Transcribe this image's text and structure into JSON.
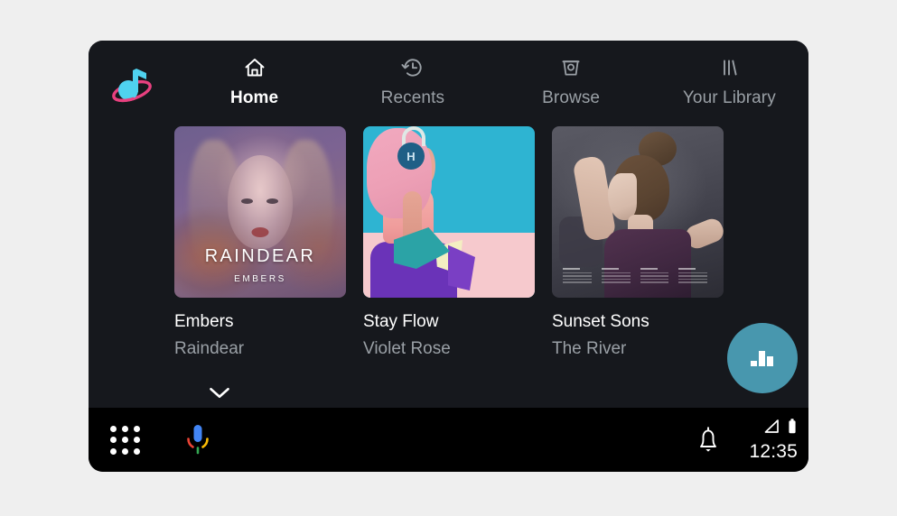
{
  "app": {
    "logo_icon": "music-note-orbit-logo",
    "background_color": "#16181d",
    "page_background": "#efefef",
    "accent_color": "#4897ae",
    "muted_text_color": "#9aa0a6"
  },
  "nav": {
    "tabs": [
      {
        "label": "Home",
        "icon": "home-icon",
        "active": true
      },
      {
        "label": "Recents",
        "icon": "history-icon",
        "active": false
      },
      {
        "label": "Browse",
        "icon": "browse-icon",
        "active": false
      },
      {
        "label": "Your Library",
        "icon": "library-icon",
        "active": false
      }
    ]
  },
  "scrollbar": {
    "up_icon": "chevron-up-icon",
    "down_icon": "chevron-down-icon"
  },
  "content": {
    "cards": [
      {
        "title": "Embers",
        "subtitle": "Raindear",
        "art_name": "album-art-embers",
        "art_wordmark": "RAINDEAR",
        "art_sub": "EMBERS"
      },
      {
        "title": "Stay Flow",
        "subtitle": "Violet Rose",
        "art_name": "album-art-stay-flow",
        "art_badge": "H"
      },
      {
        "title": "Sunset Sons",
        "subtitle": "The River",
        "art_name": "album-art-sunset-sons"
      }
    ],
    "peek_row": [
      {
        "art_name": "album-art-peek-pink"
      },
      {
        "art_name": "album-art-peek-navy"
      },
      {
        "art_name": "album-art-peek-cream"
      }
    ]
  },
  "now_playing": {
    "icon": "equalizer-bars-icon",
    "color": "#4897ae"
  },
  "system_bar": {
    "apps_icon": "apps-grid-icon",
    "mic_icon": "assistant-mic-icon",
    "bell_icon": "notification-bell-icon",
    "signal_icon": "signal-triangle-icon",
    "battery_icon": "battery-full-icon",
    "clock": "12:35"
  }
}
